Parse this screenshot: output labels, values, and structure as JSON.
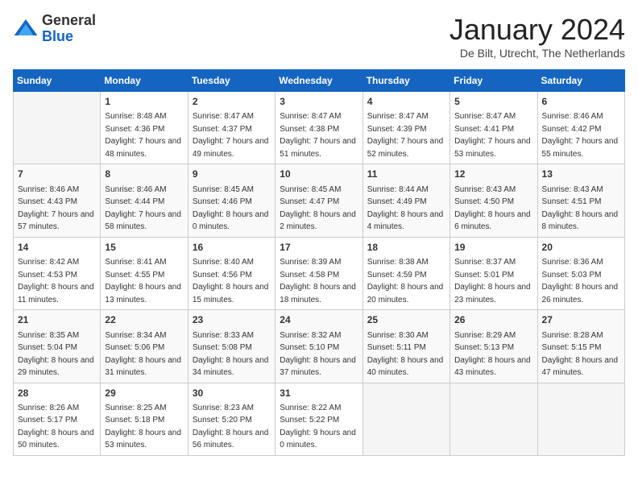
{
  "header": {
    "logo": {
      "general": "General",
      "blue": "Blue"
    },
    "title": "January 2024",
    "subtitle": "De Bilt, Utrecht, The Netherlands"
  },
  "days_header": [
    "Sunday",
    "Monday",
    "Tuesday",
    "Wednesday",
    "Thursday",
    "Friday",
    "Saturday"
  ],
  "weeks": [
    [
      {
        "day": "",
        "sunrise": "",
        "sunset": "",
        "daylight": ""
      },
      {
        "day": "1",
        "sunrise": "Sunrise: 8:48 AM",
        "sunset": "Sunset: 4:36 PM",
        "daylight": "Daylight: 7 hours and 48 minutes."
      },
      {
        "day": "2",
        "sunrise": "Sunrise: 8:47 AM",
        "sunset": "Sunset: 4:37 PM",
        "daylight": "Daylight: 7 hours and 49 minutes."
      },
      {
        "day": "3",
        "sunrise": "Sunrise: 8:47 AM",
        "sunset": "Sunset: 4:38 PM",
        "daylight": "Daylight: 7 hours and 51 minutes."
      },
      {
        "day": "4",
        "sunrise": "Sunrise: 8:47 AM",
        "sunset": "Sunset: 4:39 PM",
        "daylight": "Daylight: 7 hours and 52 minutes."
      },
      {
        "day": "5",
        "sunrise": "Sunrise: 8:47 AM",
        "sunset": "Sunset: 4:41 PM",
        "daylight": "Daylight: 7 hours and 53 minutes."
      },
      {
        "day": "6",
        "sunrise": "Sunrise: 8:46 AM",
        "sunset": "Sunset: 4:42 PM",
        "daylight": "Daylight: 7 hours and 55 minutes."
      }
    ],
    [
      {
        "day": "7",
        "sunrise": "Sunrise: 8:46 AM",
        "sunset": "Sunset: 4:43 PM",
        "daylight": "Daylight: 7 hours and 57 minutes."
      },
      {
        "day": "8",
        "sunrise": "Sunrise: 8:46 AM",
        "sunset": "Sunset: 4:44 PM",
        "daylight": "Daylight: 7 hours and 58 minutes."
      },
      {
        "day": "9",
        "sunrise": "Sunrise: 8:45 AM",
        "sunset": "Sunset: 4:46 PM",
        "daylight": "Daylight: 8 hours and 0 minutes."
      },
      {
        "day": "10",
        "sunrise": "Sunrise: 8:45 AM",
        "sunset": "Sunset: 4:47 PM",
        "daylight": "Daylight: 8 hours and 2 minutes."
      },
      {
        "day": "11",
        "sunrise": "Sunrise: 8:44 AM",
        "sunset": "Sunset: 4:49 PM",
        "daylight": "Daylight: 8 hours and 4 minutes."
      },
      {
        "day": "12",
        "sunrise": "Sunrise: 8:43 AM",
        "sunset": "Sunset: 4:50 PM",
        "daylight": "Daylight: 8 hours and 6 minutes."
      },
      {
        "day": "13",
        "sunrise": "Sunrise: 8:43 AM",
        "sunset": "Sunset: 4:51 PM",
        "daylight": "Daylight: 8 hours and 8 minutes."
      }
    ],
    [
      {
        "day": "14",
        "sunrise": "Sunrise: 8:42 AM",
        "sunset": "Sunset: 4:53 PM",
        "daylight": "Daylight: 8 hours and 11 minutes."
      },
      {
        "day": "15",
        "sunrise": "Sunrise: 8:41 AM",
        "sunset": "Sunset: 4:55 PM",
        "daylight": "Daylight: 8 hours and 13 minutes."
      },
      {
        "day": "16",
        "sunrise": "Sunrise: 8:40 AM",
        "sunset": "Sunset: 4:56 PM",
        "daylight": "Daylight: 8 hours and 15 minutes."
      },
      {
        "day": "17",
        "sunrise": "Sunrise: 8:39 AM",
        "sunset": "Sunset: 4:58 PM",
        "daylight": "Daylight: 8 hours and 18 minutes."
      },
      {
        "day": "18",
        "sunrise": "Sunrise: 8:38 AM",
        "sunset": "Sunset: 4:59 PM",
        "daylight": "Daylight: 8 hours and 20 minutes."
      },
      {
        "day": "19",
        "sunrise": "Sunrise: 8:37 AM",
        "sunset": "Sunset: 5:01 PM",
        "daylight": "Daylight: 8 hours and 23 minutes."
      },
      {
        "day": "20",
        "sunrise": "Sunrise: 8:36 AM",
        "sunset": "Sunset: 5:03 PM",
        "daylight": "Daylight: 8 hours and 26 minutes."
      }
    ],
    [
      {
        "day": "21",
        "sunrise": "Sunrise: 8:35 AM",
        "sunset": "Sunset: 5:04 PM",
        "daylight": "Daylight: 8 hours and 29 minutes."
      },
      {
        "day": "22",
        "sunrise": "Sunrise: 8:34 AM",
        "sunset": "Sunset: 5:06 PM",
        "daylight": "Daylight: 8 hours and 31 minutes."
      },
      {
        "day": "23",
        "sunrise": "Sunrise: 8:33 AM",
        "sunset": "Sunset: 5:08 PM",
        "daylight": "Daylight: 8 hours and 34 minutes."
      },
      {
        "day": "24",
        "sunrise": "Sunrise: 8:32 AM",
        "sunset": "Sunset: 5:10 PM",
        "daylight": "Daylight: 8 hours and 37 minutes."
      },
      {
        "day": "25",
        "sunrise": "Sunrise: 8:30 AM",
        "sunset": "Sunset: 5:11 PM",
        "daylight": "Daylight: 8 hours and 40 minutes."
      },
      {
        "day": "26",
        "sunrise": "Sunrise: 8:29 AM",
        "sunset": "Sunset: 5:13 PM",
        "daylight": "Daylight: 8 hours and 43 minutes."
      },
      {
        "day": "27",
        "sunrise": "Sunrise: 8:28 AM",
        "sunset": "Sunset: 5:15 PM",
        "daylight": "Daylight: 8 hours and 47 minutes."
      }
    ],
    [
      {
        "day": "28",
        "sunrise": "Sunrise: 8:26 AM",
        "sunset": "Sunset: 5:17 PM",
        "daylight": "Daylight: 8 hours and 50 minutes."
      },
      {
        "day": "29",
        "sunrise": "Sunrise: 8:25 AM",
        "sunset": "Sunset: 5:18 PM",
        "daylight": "Daylight: 8 hours and 53 minutes."
      },
      {
        "day": "30",
        "sunrise": "Sunrise: 8:23 AM",
        "sunset": "Sunset: 5:20 PM",
        "daylight": "Daylight: 8 hours and 56 minutes."
      },
      {
        "day": "31",
        "sunrise": "Sunrise: 8:22 AM",
        "sunset": "Sunset: 5:22 PM",
        "daylight": "Daylight: 9 hours and 0 minutes."
      },
      {
        "day": "",
        "sunrise": "",
        "sunset": "",
        "daylight": ""
      },
      {
        "day": "",
        "sunrise": "",
        "sunset": "",
        "daylight": ""
      },
      {
        "day": "",
        "sunrise": "",
        "sunset": "",
        "daylight": ""
      }
    ]
  ]
}
